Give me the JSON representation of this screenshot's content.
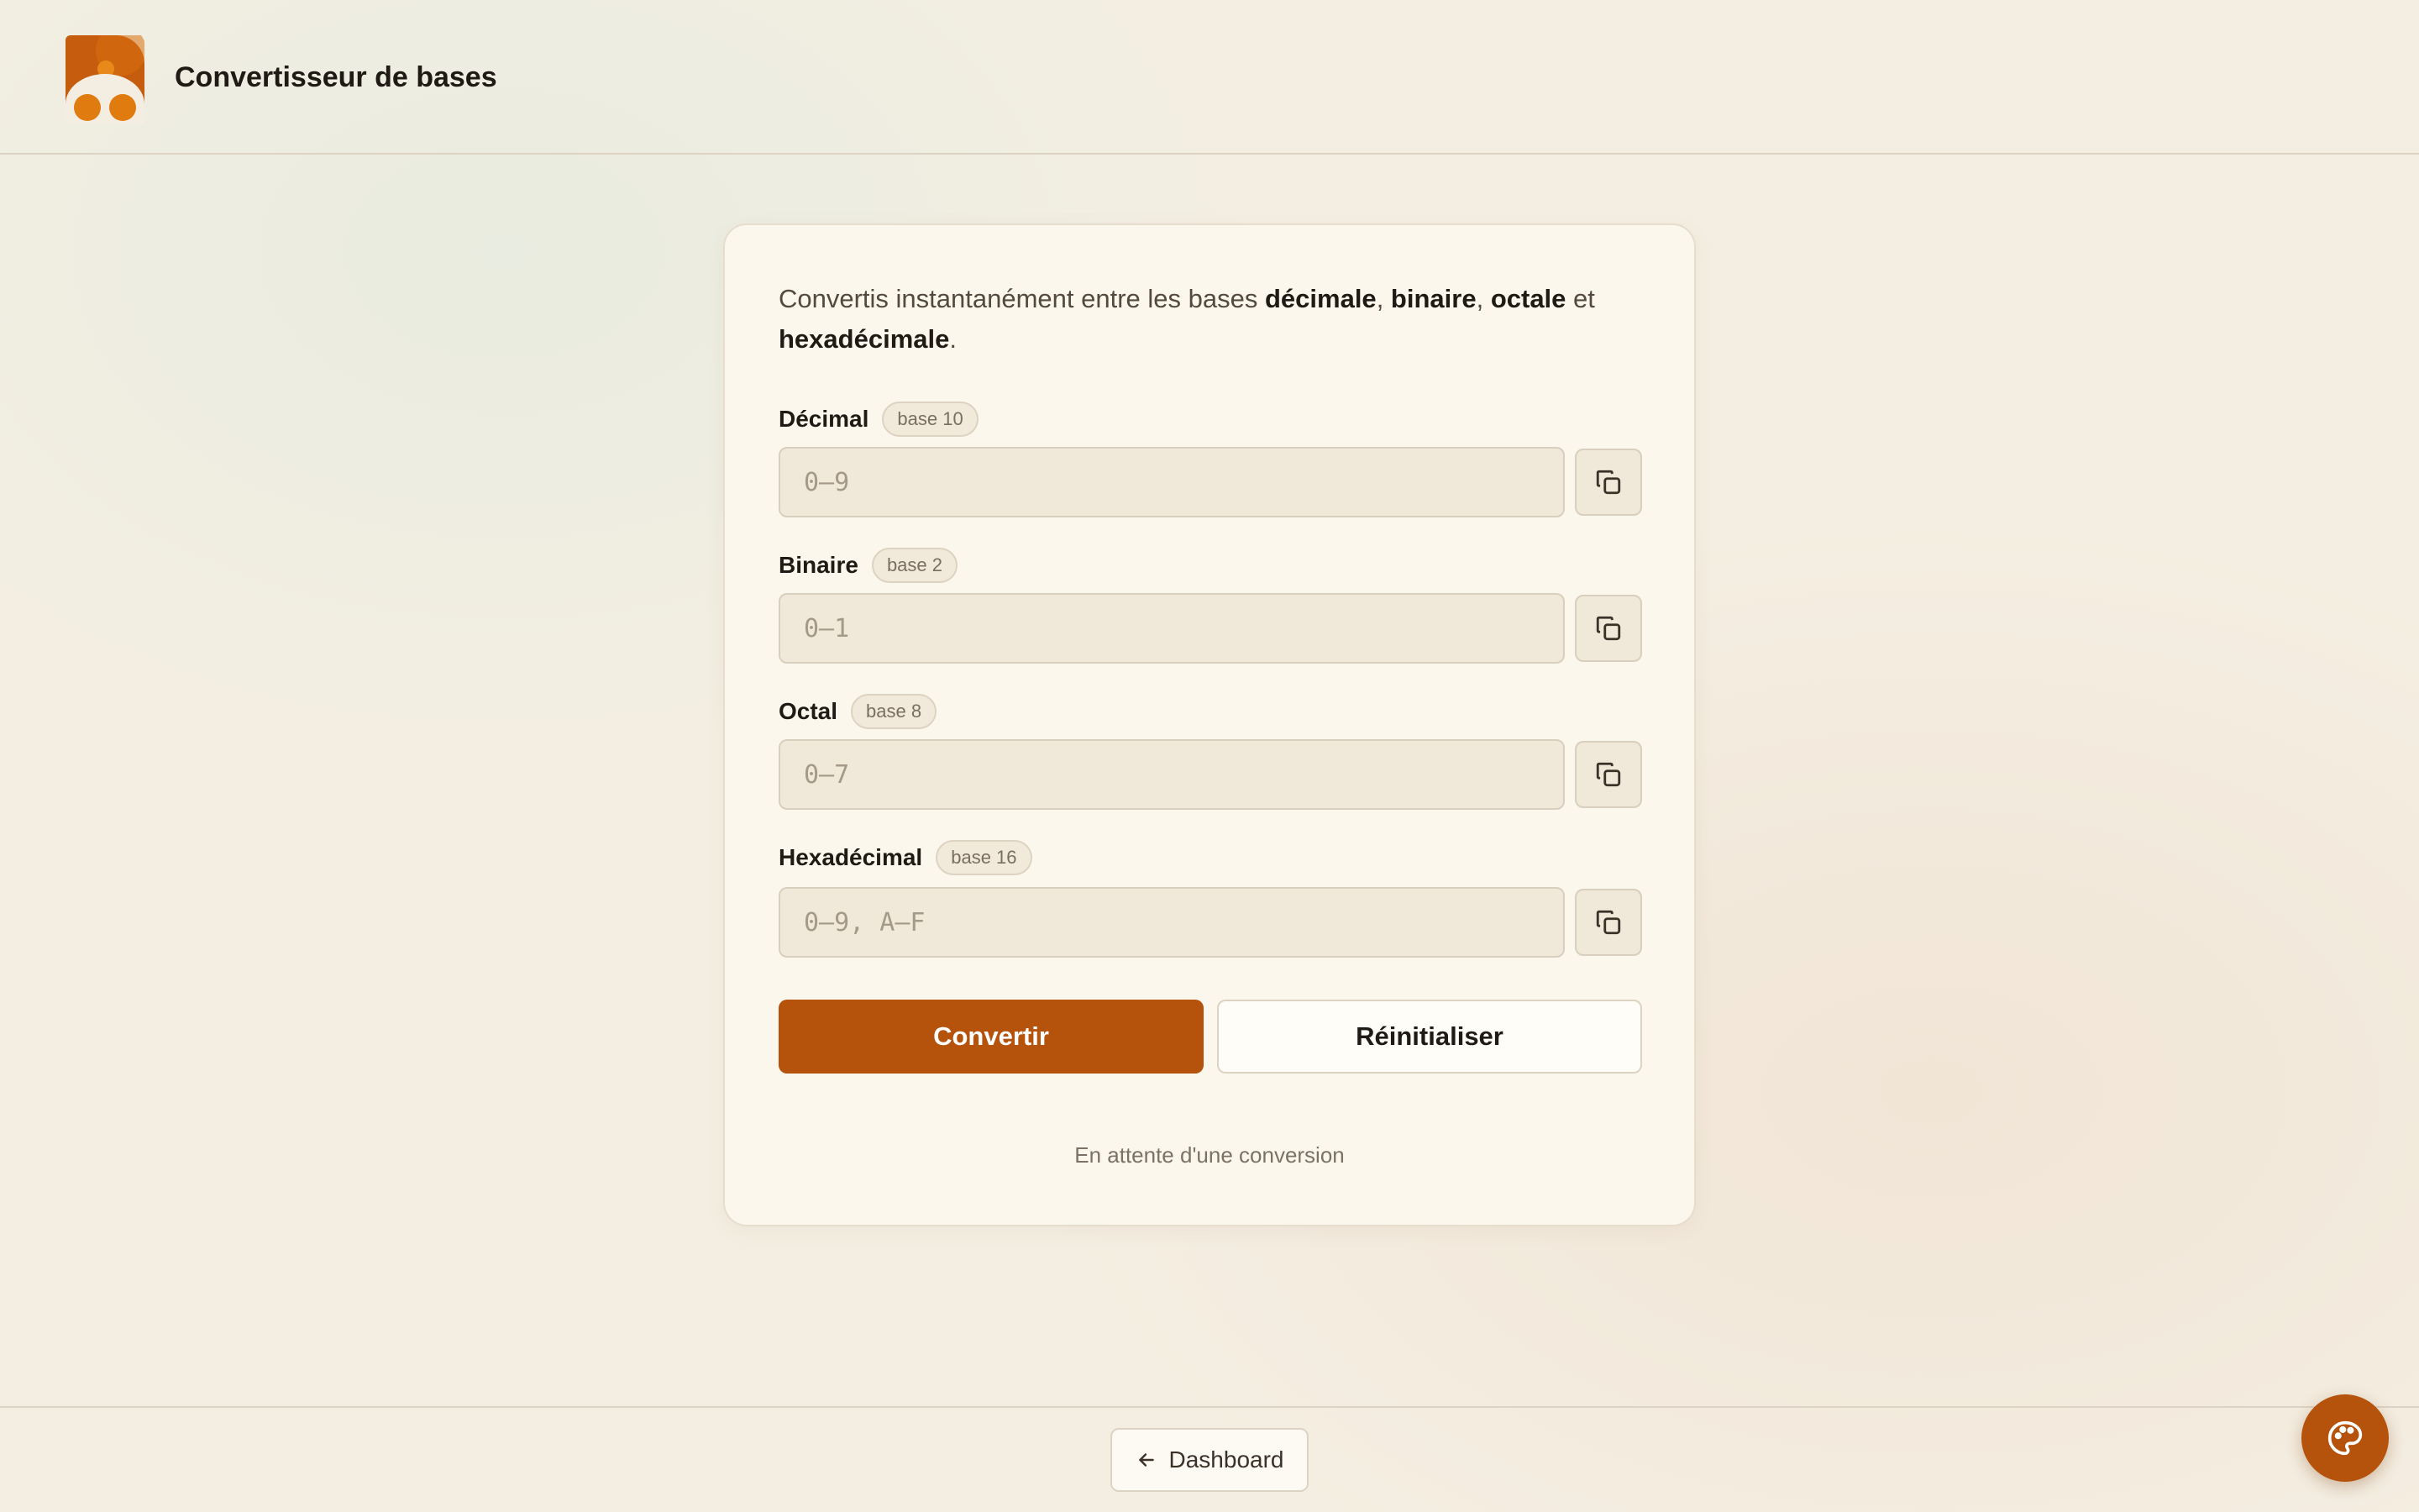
{
  "header": {
    "title": "Convertisseur de bases"
  },
  "intro": {
    "prefix": "Convertis instantanément entre les bases ",
    "b1": "décimale",
    "sep1": ", ",
    "b2": "binaire",
    "sep2": ", ",
    "b3": "octale",
    "sep3": " et ",
    "b4": "hexadécimale",
    "suffix": "."
  },
  "fields": [
    {
      "label": "Décimal",
      "badge": "base 10",
      "placeholder": "0–9",
      "value": ""
    },
    {
      "label": "Binaire",
      "badge": "base 2",
      "placeholder": "0–1",
      "value": ""
    },
    {
      "label": "Octal",
      "badge": "base 8",
      "placeholder": "0–7",
      "value": ""
    },
    {
      "label": "Hexadécimal",
      "badge": "base 16",
      "placeholder": "0–9, A–F",
      "value": ""
    }
  ],
  "actions": {
    "convert": "Convertir",
    "reset": "Réinitialiser"
  },
  "status": "En attente d'une conversion",
  "footer": {
    "dashboard": "Dashboard"
  },
  "colors": {
    "accent": "#b5520b",
    "background": "#f4eee2",
    "card": "#fbf7ec"
  },
  "icons": {
    "copy": "copy-icon",
    "back": "arrow-left-icon",
    "theme": "palette-icon",
    "logo": "app-logo-icon"
  }
}
